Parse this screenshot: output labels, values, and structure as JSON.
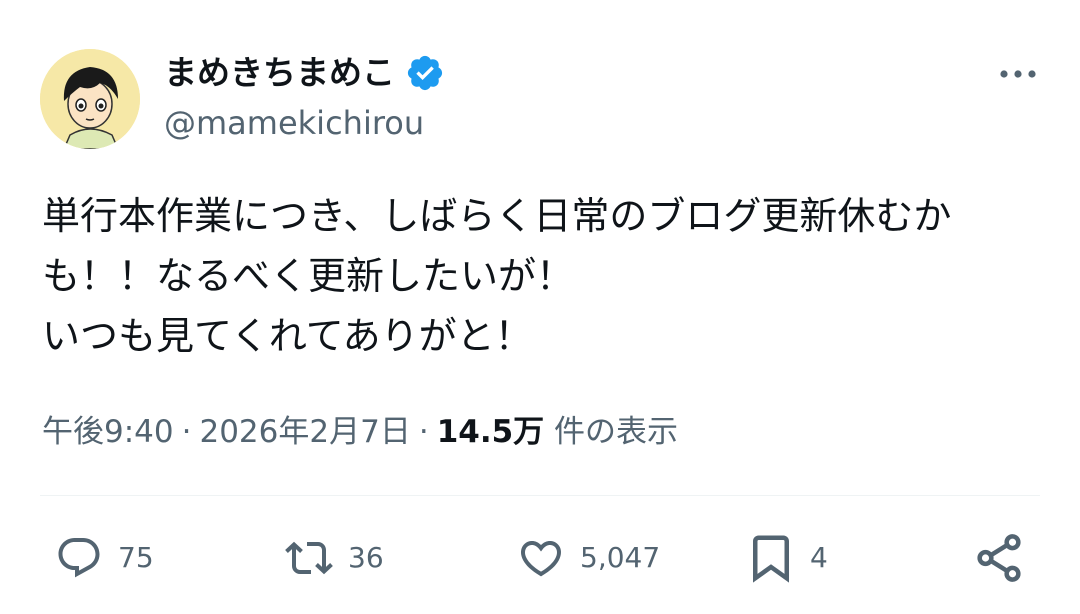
{
  "author": {
    "display_name": "まめきちまめこ",
    "handle": "@mamekichirou",
    "verified": true
  },
  "tweet": {
    "lines": [
      "単行本作業につき、しばらく日常のブログ更新休むか",
      "も！！なるべく更新したいが！",
      "いつも見てくれてありがと！"
    ]
  },
  "meta": {
    "time": "午後9:40",
    "separator": "·",
    "date": "2026年2月7日",
    "views_count": "14.5万",
    "views_label": "件の表示"
  },
  "actions": {
    "replies": "75",
    "retweets": "36",
    "likes": "5,047",
    "bookmarks": "4"
  },
  "colors": {
    "text": "#0f1419",
    "secondary": "#536471",
    "verified": "#1d9bf0",
    "divider": "#eff3f4"
  },
  "icons": {
    "verified": "verified-badge-icon",
    "more": "more-dots-icon",
    "reply": "reply-icon",
    "retweet": "retweet-icon",
    "like": "heart-icon",
    "bookmark": "bookmark-icon",
    "share": "share-icon"
  }
}
